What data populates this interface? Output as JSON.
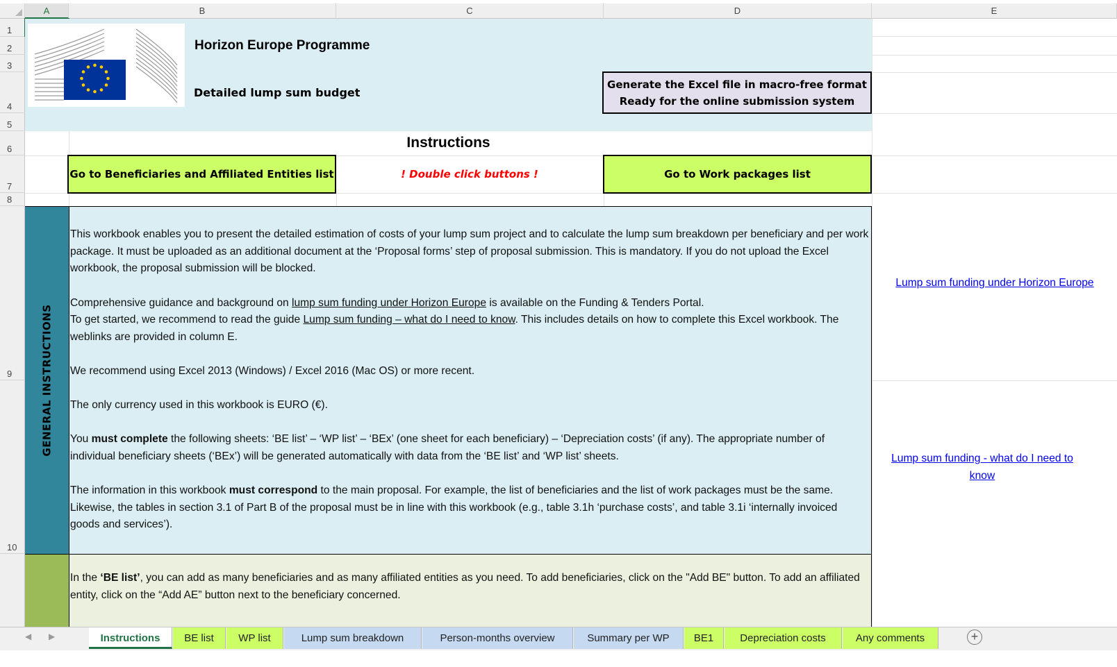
{
  "columns": [
    "A",
    "B",
    "C",
    "D",
    "E"
  ],
  "rows": [
    "1",
    "2",
    "3",
    "4",
    "5",
    "6",
    "7",
    "8",
    "9",
    "10"
  ],
  "header": {
    "programme_title": "Horizon Europe Programme",
    "subtitle": "Detailed lump sum budget",
    "generate_button_line1": "Generate the Excel file in macro-free format",
    "generate_button_line2": "Ready for the online submission system"
  },
  "instructions_title": "Instructions",
  "buttons": {
    "be_list": "Go to Beneficiaries and Affiliated Entities list",
    "double_click_note": "! Double click buttons !",
    "wp_list": "Go to Work packages list"
  },
  "general": {
    "side_label": "GENERAL INSTRUCTIONS",
    "p1": "This workbook enables you to present the detailed estimation of costs of your lump sum project and to calculate the lump sum breakdown per beneficiary and per work package. It must be uploaded as an additional document at the ‘Proposal forms’ step of proposal submission. This is mandatory. If you do not upload the Excel workbook, the proposal submission will be blocked.",
    "p2_a": "Comprehensive guidance and background on ",
    "p2_link": "lump sum funding under Horizon Europe",
    "p2_b": " is available on the Funding & Tenders Portal.",
    "p3_a": "To get started, we recommend to read the guide ",
    "p3_link": "Lump sum funding – what do I need to know",
    "p3_b": ". This includes details on how to complete this Excel workbook. The weblinks are provided in column E.",
    "p4": "We recommend using Excel 2013 (Windows) / Excel 2016 (Mac OS) or more recent.",
    "p5": "The only currency used in this workbook is EURO (€).",
    "p6_a": "You ",
    "p6_bold": "must complete",
    "p6_b": " the following sheets: ‘BE list’ – ‘WP list’ – ‘BEx’ (one sheet for each beneficiary) – ‘Depreciation costs’ (if any). The appropriate number of individual beneficiary sheets (‘BEx’) will be generated automatically with data from the ‘BE list’ and ‘WP list’ sheets.",
    "p7_a": "The information in this workbook ",
    "p7_bold": "must correspond",
    "p7_b": " to the main proposal. For example, the list of beneficiaries and the list of work packages must be the same. Likewise, the tables in section 3.1 of Part B of the proposal must be in line with this workbook (e.g., table 3.1h ‘purchase costs’, and table 3.1i ‘internally invoiced goods and services’)."
  },
  "be_section": {
    "p1_a": "In the ",
    "p1_bold": "‘BE list’",
    "p1_b": ", you can add as many beneficiaries and as many affiliated entities as you need. To add beneficiaries, click on the \"Add BE\" button. To add an affiliated entity, click on the “Add AE” button next to the beneficiary concerned."
  },
  "links": {
    "link1": "Lump sum funding under Horizon Europe",
    "link2": "Lump sum funding - what do I need to know"
  },
  "tabs": [
    {
      "label": "Instructions",
      "color": "#ffffff",
      "active": true
    },
    {
      "label": "BE list",
      "color": "#ccff66"
    },
    {
      "label": "WP list",
      "color": "#ccff66"
    },
    {
      "label": "Lump sum breakdown",
      "color": "#c5d9f1"
    },
    {
      "label": "Person-months overview",
      "color": "#c5d9f1"
    },
    {
      "label": "Summary per WP",
      "color": "#c5d9f1"
    },
    {
      "label": "BE1",
      "color": "#ccff66"
    },
    {
      "label": "Depreciation costs",
      "color": "#ccff66"
    },
    {
      "label": "Any comments",
      "color": "#ccff66"
    }
  ],
  "colors": {
    "header_band": "#daeef3",
    "general_side": "#31869b",
    "be_side": "#9bbb59",
    "be_body": "#ebf1de",
    "button_green": "#ccff66",
    "button_purple": "#e4dfec",
    "accent": "#217346"
  }
}
